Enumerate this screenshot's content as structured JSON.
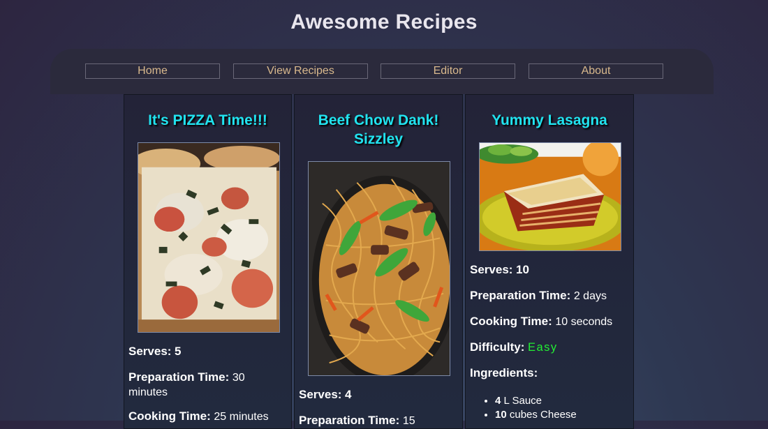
{
  "site": {
    "title": "Awesome Recipes"
  },
  "nav": {
    "items": [
      {
        "label": "Home"
      },
      {
        "label": "View Recipes"
      },
      {
        "label": "Editor"
      },
      {
        "label": "About"
      }
    ]
  },
  "labels": {
    "serves": "Serves:",
    "prep": "Preparation Time:",
    "cook": "Cooking Time:",
    "difficulty": "Difficulty:",
    "ingredients": "Ingredients:"
  },
  "recipes": [
    {
      "title": "It's PIZZA Time!!!",
      "serves": "5",
      "prep_time": "30 minutes",
      "cook_time": "25 minutes"
    },
    {
      "title": "Beef Chow Dank! Sizzley",
      "serves": "4",
      "prep_time": "15"
    },
    {
      "title": "Yummy Lasagna",
      "serves": "10",
      "prep_time": "2 days",
      "cook_time": "10 seconds",
      "difficulty": "Easy",
      "ingredients": [
        {
          "qty": "4",
          "item": "L Sauce"
        },
        {
          "qty": "10",
          "item": "cubes Cheese"
        }
      ]
    }
  ]
}
